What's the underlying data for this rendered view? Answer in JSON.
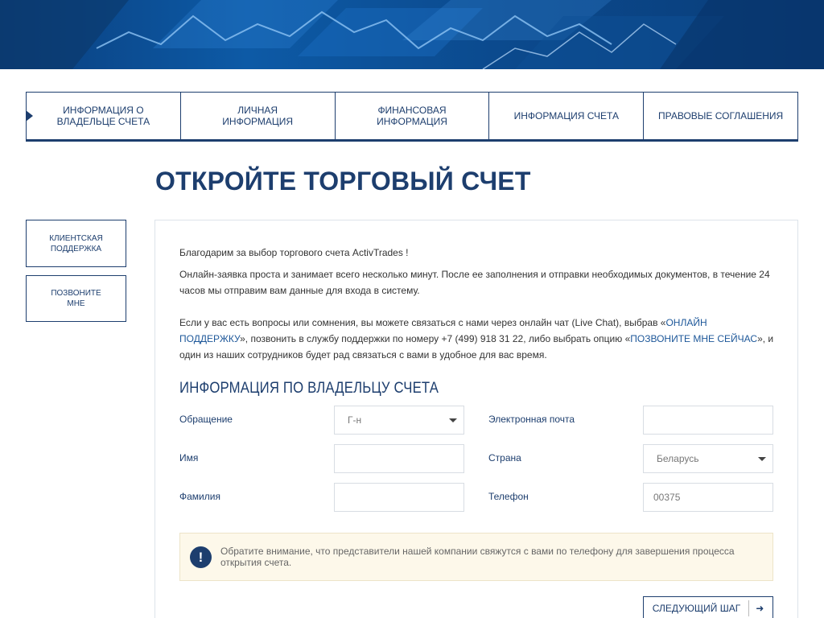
{
  "steps": [
    {
      "label": "ИНФОРМАЦИЯ О\nВЛАДЕЛЬЦЕ СЧЕТА"
    },
    {
      "label": "ЛИЧНАЯ\nИНФОРМАЦИЯ"
    },
    {
      "label": "ФИНАНСОВАЯ\nИНФОРМАЦИЯ"
    },
    {
      "label": "ИНФОРМАЦИЯ СЧЕТА"
    },
    {
      "label": "ПРАВОВЫЕ СОГЛАШЕНИЯ"
    }
  ],
  "page_title": "ОТКРОЙТЕ ТОРГОВЫЙ СЧЕТ",
  "sidebar": {
    "support_label": "КЛИЕНТСКАЯ\nПОДДЕРЖКА",
    "call_label": "ПОЗВОНИТЕ\nМНЕ"
  },
  "intro": {
    "thanks": "Благодарим за выбор торгового счета ActivTrades !",
    "para1": "Онлайн-заявка проста и занимает всего несколько минут. После ее заполнения и отправки необходимых документов, в течение 24 часов мы отправим вам данные для входа в систему.",
    "para2_part1": "Если у вас есть вопросы или сомнения, вы можете связаться с нами через онлайн чат (Live Chat), выбрав «",
    "link_support": "ОНЛАЙН ПОДДЕРЖКУ",
    "para2_part2": "», позвонить в службу поддержки по номеру +7 (499) 918 31 22, либо выбрать опцию «",
    "link_call": "ПОЗВОНИТЕ МНЕ СЕЙЧАС",
    "para2_part3": "», и один из наших сотрудников будет рад связаться с вами в удобное для вас время."
  },
  "section_title": "ИНФОРМАЦИЯ ПО ВЛАДЕЛЬЦУ СЧЕТА",
  "form": {
    "salutation_label": "Обращение",
    "salutation_value": "Г-н",
    "first_name_label": "Имя",
    "first_name_value": "",
    "last_name_label": "Фамилия",
    "last_name_value": "",
    "email_label": "Электронная почта",
    "email_value": "",
    "country_label": "Страна",
    "country_value": "Беларусь",
    "phone_label": "Телефон",
    "phone_value": "00375"
  },
  "notice": {
    "icon": "!",
    "text": "Обратите внимание, что представители нашей компании свяжутся с вами по телефону для завершения процесса открытия счета."
  },
  "next_button": {
    "label": "СЛЕДУЮЩИЙ ШАГ",
    "arrow": "➜"
  },
  "colors": {
    "brand_navy": "#1d3e6e",
    "link": "#1d5799",
    "notice_bg": "#fdf8ea"
  }
}
